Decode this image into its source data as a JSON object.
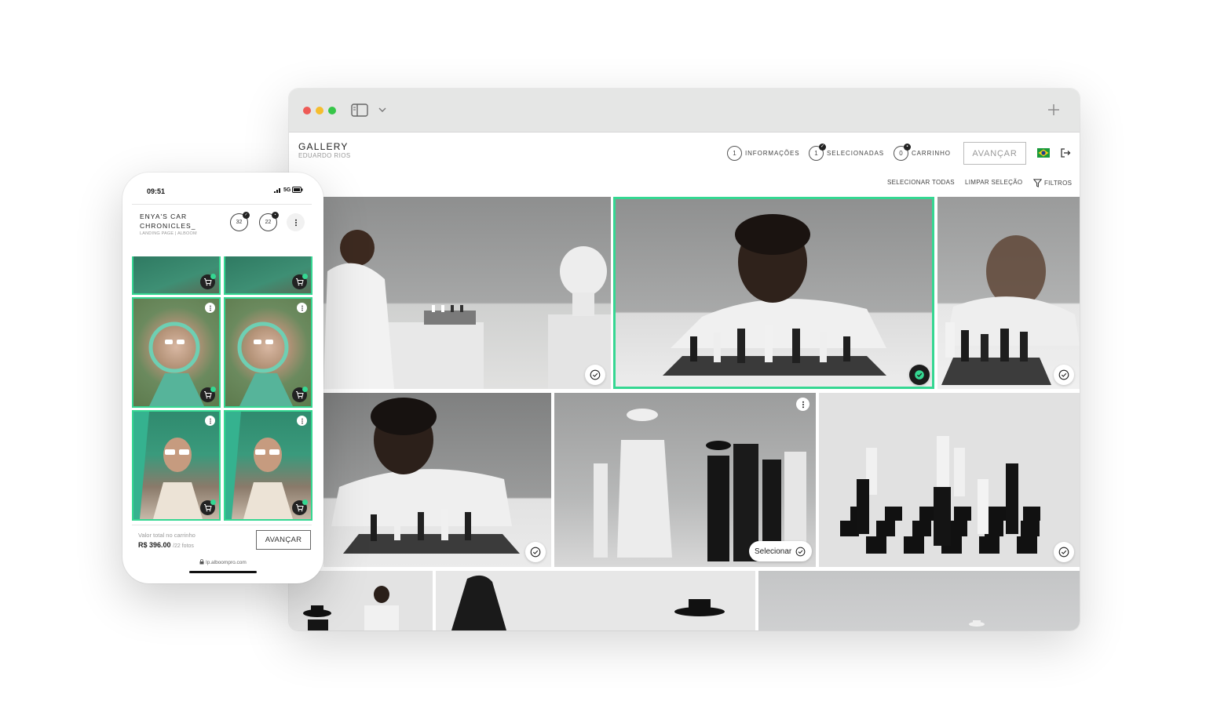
{
  "desktop": {
    "gallery": {
      "title": "GALLERY",
      "subtitle": "EDUARDO RIOS"
    },
    "steps": [
      {
        "num": "1",
        "label": "INFORMAÇÕES"
      },
      {
        "num": "1",
        "label": "SELECIONADAS"
      },
      {
        "num": "0",
        "label": "CARRINHO"
      }
    ],
    "advance_label": "AVANÇAR",
    "toolbar": {
      "select_all": "SELECIONAR TODAS",
      "clear": "LIMPAR SELEÇÃO",
      "filters": "FILTROS"
    },
    "photo_select_label": "Selecionar",
    "icons": [
      "sidebar-icon",
      "chevron-down-icon",
      "plus-icon",
      "brazil-flag-icon",
      "logout-icon",
      "filter-icon",
      "check-circle-icon",
      "more-icon"
    ],
    "colors": {
      "accent": "#35d792",
      "selected_border": "#35d792"
    }
  },
  "mobile": {
    "status": {
      "time": "09:51",
      "network": "5G"
    },
    "title": "ENYA'S CAR CHRONICLES_",
    "subtitle": "LANDING PAGE | ALBOOM",
    "badges": [
      "32",
      "22"
    ],
    "cart_label": "Valor total no carrinho",
    "cart_total": "R$ 396.00",
    "cart_count": "/22 fotos",
    "advance_label": "AVANÇAR",
    "url": "lp.alboompro.com"
  }
}
